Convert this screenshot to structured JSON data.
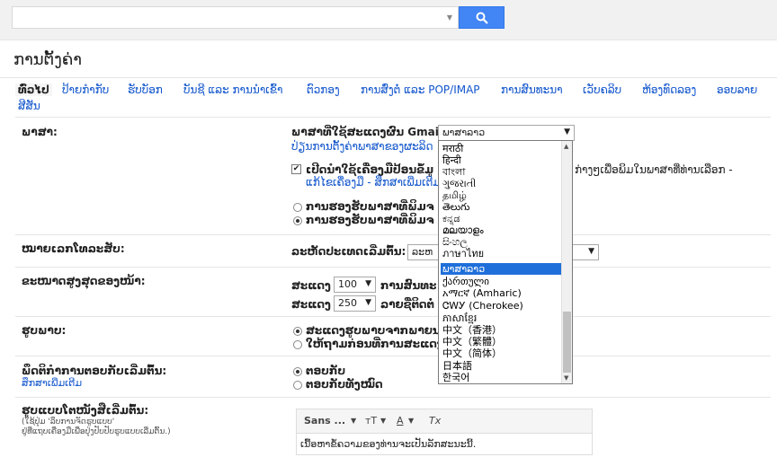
{
  "search": {
    "placeholder": ""
  },
  "page_title": "ການຕັ້ງຄ່າ",
  "tabs": [
    "ທົ່ວໄປ",
    "ປ້າຍກຳກັບ",
    "ຮັບບັອກ",
    "ບັນຊີ ແລະ ການນຳເຂົ້າ",
    "ຕົວກອງ",
    "ການສົ່ງຕໍ່ ແລະ POP/IMAP",
    "ການສົນທະນາ",
    "ເວັບຄລິບ",
    "ຫ້ອງທົດລອງ",
    "ອອບລາຍ",
    "ສີສັນ"
  ],
  "language": {
    "label": "ພາສາ:",
    "display_label": "ພາສາທີ່ໃຊ້ສະແດງຜົນ Gmail:",
    "selected": "ພາສາລາວ",
    "other_link": "ປ່ຽນການຕັ້ງຄ່າພາສາຂອງຜະລິດ",
    "enable_input_text": "ເປີດນຳໃຊ້ເຄື່ອງມືປ້ອນຂໍ້ມູ",
    "enable_input_tail": "ກ່າງໆເພື່ອພິມໃນພາສາທີ່ທ່ານເລືອກ -",
    "edit_tools_link": "ແກ້ໄຂເຄື່ອງມື - ສຶກສາເພີ່ມເຕີມ",
    "radio1": "ການຮອງຮັບພາສາທີ່ພິມຈ",
    "radio2": "ການຮອງຮັບພາສາທີ່ພິມຈ"
  },
  "phone": {
    "label": "ໝາຍເລກໂທລະສັບ:",
    "default_country": "ລະຫັດປະເທດເລີ່ມຕົ້ນ:",
    "country_value": "ລະຫ"
  },
  "page_size": {
    "label": "ຂະໜາດສູງສຸດຂອງໜ້າ:",
    "show": "ສະແດງ",
    "conversations_value": "100",
    "conversations_label": "ການສົນທະ",
    "contacts_value": "250",
    "contacts_label": "ລາຍຊື່ຕິດຕໍ່"
  },
  "images": {
    "label": "ຮູບພາບ:",
    "radio1": "ສະແດງຮູບພາບຈາກພາຍນ",
    "radio2": "ໃຫ້ຖາມກ່ອນທີ່ການສະແດງ"
  },
  "reply": {
    "label": "ພຶດຕິກຳການຕອບກັບເລີ່ມຕົ້ນ:",
    "link": "ສຶກສາເພີ່ມເຕີມ",
    "radio1": "ຕອບກັບ",
    "radio2": "ຕອບກັບທັງໝົດ"
  },
  "text_style": {
    "label": "ຮູບແບບໂຕໜັງສືເລີ່ມຕົ້ນ:",
    "note1": "(ໃຊ້ປຸ່ມ 'ລຶບການຈັດຮູບແບບ'",
    "note2": "ຢູ່ທີ່ແຖບເຄື່ອງມືເພື່ອປຸ່ງປັບປັບຮູບແບບເລີ່ມຕົ້ນ.)",
    "font": "Sans ...",
    "size_icon": "тT",
    "color_icon": "A",
    "clear_icon": "Tx",
    "preview": "ເນື້ອຫາຂໍ້ຄວາມຂອງທ່ານຈະເປັນລັກສະນະນີ້."
  },
  "dropdown_options": [
    "मराठी",
    "हिन्दी",
    "বাংলা",
    "ગુજરાતી",
    "தமிழ்",
    "తెలుగు",
    "ಕನ್ನಡ",
    "മലയാളം",
    "සිංහල",
    "ภาษาไทย",
    "ພາສາລາວ",
    "ქართული",
    "አማርኛ (Amharic)",
    "ᏣᎳᎩ (Cherokee)",
    "ភាសាខ្មែរ",
    "中文（香港）",
    "中文（繁體）",
    "中文（简体）",
    "日本語",
    "한국어"
  ],
  "colors": {
    "accent": "#4285f4",
    "link": "#1155cc",
    "selected": "#1e6fd9"
  }
}
